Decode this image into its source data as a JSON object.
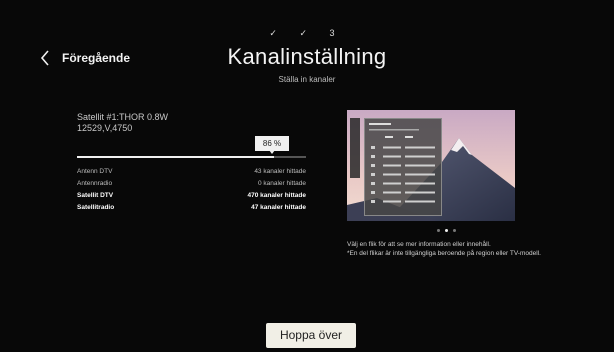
{
  "steps": {
    "step1": "✓",
    "step2": "✓",
    "step3": "3"
  },
  "header": {
    "back_label": "Föregående",
    "title": "Kanalinställning",
    "subtitle": "Ställa in kanaler"
  },
  "scan": {
    "satellite_line1": "Satellit #1:THOR 0.8W",
    "satellite_line2": "12529,V,4750",
    "progress_label": "86 %",
    "progress_value": 0.86,
    "results": [
      {
        "name": "Antenn DTV",
        "count": "43 kanaler hittade",
        "style": "dim"
      },
      {
        "name": "Antennradio",
        "count": "0 kanaler hittade",
        "style": "dim"
      },
      {
        "name": "Satellit DTV",
        "count": "470 kanaler hittade",
        "style": "bold"
      },
      {
        "name": "Satellitradio",
        "count": "47 kanaler hittade",
        "style": "bold"
      }
    ]
  },
  "preview": {
    "pages": 3,
    "active_page": 2,
    "info_line1": "Välj en flik för att se mer information eller innehåll.",
    "info_line2": "*En del flikar är inte tillgängliga beroende på region eller TV-modell."
  },
  "footer": {
    "skip_label": "Hoppa över"
  },
  "colors": {
    "background": "#080808",
    "accent_button": "#f1efe6",
    "progress_fill": "#f0f0f0",
    "progress_track": "#555555"
  }
}
